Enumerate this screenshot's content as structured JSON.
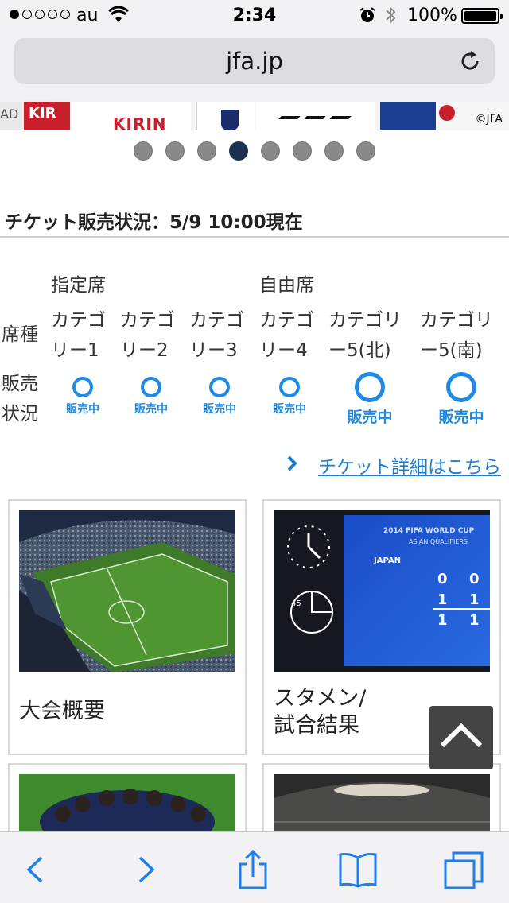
{
  "status_bar": {
    "carrier": "au",
    "time": "2:34",
    "battery": "100%",
    "signal_bars": 1
  },
  "url_bar": {
    "domain": "jfa.jp"
  },
  "banner": {
    "sponsor_1": "AD",
    "sponsor_2": "KIR",
    "sponsor_3": "KIRIN",
    "copyright": "©JFA"
  },
  "pager": {
    "count": 8,
    "active_index": 3
  },
  "ticket": {
    "title": "チケット販売状況：5/9 10:00現在",
    "row_label_seat": "席種",
    "row_label_sale_1": "販売",
    "row_label_sale_2": "状況",
    "group_reserved": "指定席",
    "group_free": "自由席",
    "categories": [
      {
        "line1": "カテゴ",
        "line2": "リー1",
        "status": "販売中"
      },
      {
        "line1": "カテゴ",
        "line2": "リー2",
        "status": "販売中"
      },
      {
        "line1": "カテゴ",
        "line2": "リー3",
        "status": "販売中"
      },
      {
        "line1": "カテゴ",
        "line2": "リー4",
        "status": "販売中"
      },
      {
        "line1": "カテゴリ",
        "line2": "ー5(北)",
        "status": "販売中"
      },
      {
        "line1": "カテゴリ",
        "line2": "ー5(南)",
        "status": "販売中"
      }
    ],
    "status_color": "#1e8ae6",
    "detail_link": "チケット詳細はこちら"
  },
  "cards": [
    {
      "caption_1": "大会概要",
      "caption_2": ""
    },
    {
      "caption_1": "スタメン/",
      "caption_2": "試合結果"
    },
    {
      "caption_1": "",
      "caption_2": ""
    },
    {
      "caption_1": "",
      "caption_2": ""
    }
  ],
  "scoreboard": {
    "header": "2014 FIFA WORLD CUP",
    "sub": "ASIAN QUALIFIERS",
    "team": "JAPAN",
    "score_1h": "0",
    "score_2h": "1",
    "score_total": "1",
    "score_opp_1h": "0",
    "score_opp_2h": "1",
    "score_opp_total": "1",
    "minute": "45"
  },
  "toolbar": {
    "icons": [
      "back-icon",
      "forward-icon",
      "share-icon",
      "bookmarks-icon",
      "tabs-icon"
    ]
  }
}
